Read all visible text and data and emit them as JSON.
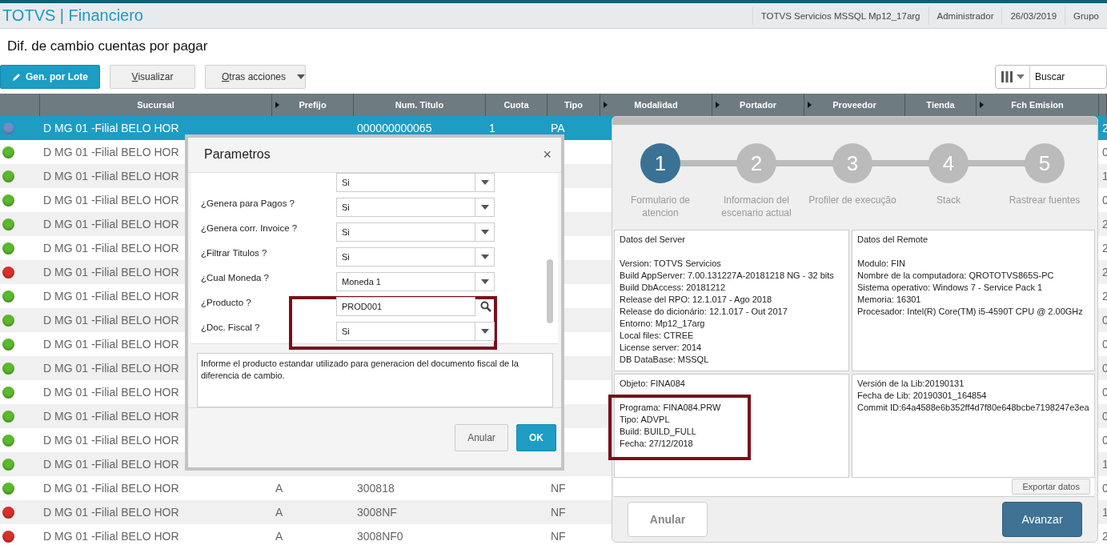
{
  "app": {
    "title": "TOTVS | Financiero",
    "info": [
      "TOTVS Servicios MSSQL Mp12_17arg",
      "Administrador",
      "26/03/2019",
      "Grupo"
    ]
  },
  "page_title": "Dif. de cambio cuentas por pagar",
  "toolbar": {
    "buttons": [
      {
        "label": "Gen. por Lote",
        "kind": "primary"
      },
      {
        "label": "Visualizar",
        "kind": "plain"
      },
      {
        "label": "Otras acciones",
        "kind": "menu"
      }
    ],
    "search": {
      "placeholder": "Buscar"
    }
  },
  "table": {
    "columns": [
      {
        "expandable": false
      },
      {
        "label": "Sucursal",
        "expandable": false
      },
      {
        "label": "Prefijo",
        "expandable": true
      },
      {
        "label": "Num. Titulo",
        "expandable": false
      },
      {
        "label": "Cuota",
        "expandable": false
      },
      {
        "label": "Tipo",
        "expandable": false
      },
      {
        "label": "Modalidad",
        "expandable": true
      },
      {
        "label": "Portador",
        "expandable": true
      },
      {
        "label": "Proveedor",
        "expandable": true
      },
      {
        "label": "Tienda",
        "expandable": false
      },
      {
        "label": "Fch Emision",
        "expandable": true
      },
      {
        "expandable": false
      }
    ],
    "rows": [
      {
        "selected": true,
        "color": "#6f8fc8",
        "cells": [
          "",
          "D MG 01 -Filial BELO HOR",
          "",
          "000000000065",
          "1",
          "PA",
          "",
          "",
          "",
          "",
          "",
          "2"
        ]
      },
      {
        "selected": false,
        "color": "#5cb82e",
        "cells": [
          "",
          "D MG 01 -Filial BELO HOR",
          "",
          "",
          "",
          "",
          "",
          "",
          "",
          "",
          "",
          "0"
        ]
      },
      {
        "selected": false,
        "color": "#5cb82e",
        "cells": [
          "",
          "D MG 01 -Filial BELO HOR",
          "",
          "",
          "",
          "",
          "",
          "",
          "",
          "",
          "",
          "1"
        ]
      },
      {
        "selected": false,
        "color": "#5cb82e",
        "cells": [
          "",
          "D MG 01 -Filial BELO HOR",
          "",
          "",
          "",
          "",
          "",
          "",
          "",
          "",
          "",
          "0"
        ]
      },
      {
        "selected": false,
        "color": "#5cb82e",
        "cells": [
          "",
          "D MG 01 -Filial BELO HOR",
          "",
          "",
          "",
          "",
          "",
          "",
          "",
          "",
          "",
          "2"
        ]
      },
      {
        "selected": false,
        "color": "#5cb82e",
        "cells": [
          "",
          "D MG 01 -Filial BELO HOR",
          "",
          "",
          "",
          "",
          "",
          "",
          "",
          "",
          "",
          "2"
        ]
      },
      {
        "selected": false,
        "color": "#d9302c",
        "cells": [
          "",
          "D MG 01 -Filial BELO HOR",
          "",
          "",
          "",
          "",
          "",
          "",
          "",
          "",
          "",
          "2"
        ]
      },
      {
        "selected": false,
        "color": "#5cb82e",
        "cells": [
          "",
          "D MG 01 -Filial BELO HOR",
          "",
          "",
          "",
          "",
          "",
          "",
          "",
          "",
          "",
          "2"
        ]
      },
      {
        "selected": false,
        "color": "#5cb82e",
        "cells": [
          "",
          "D MG 01 -Filial BELO HOR",
          "",
          "",
          "",
          "",
          "",
          "",
          "",
          "",
          "",
          "0"
        ]
      },
      {
        "selected": false,
        "color": "#5cb82e",
        "cells": [
          "",
          "D MG 01 -Filial BELO HOR",
          "",
          "",
          "",
          "",
          "",
          "",
          "",
          "",
          "",
          "0"
        ]
      },
      {
        "selected": false,
        "color": "#5cb82e",
        "cells": [
          "",
          "D MG 01 -Filial BELO HOR",
          "",
          "",
          "",
          "",
          "",
          "",
          "",
          "",
          "",
          "0"
        ]
      },
      {
        "selected": false,
        "color": "#5cb82e",
        "cells": [
          "",
          "D MG 01 -Filial BELO HOR",
          "",
          "",
          "",
          "",
          "",
          "",
          "",
          "",
          "",
          "0"
        ]
      },
      {
        "selected": false,
        "color": "#5cb82e",
        "cells": [
          "",
          "D MG 01 -Filial BELO HOR",
          "",
          "",
          "",
          "",
          "",
          "",
          "",
          "",
          "",
          "0"
        ]
      },
      {
        "selected": false,
        "color": "#5cb82e",
        "cells": [
          "",
          "D MG 01 -Filial BELO HOR",
          "",
          "",
          "",
          "",
          "",
          "",
          "",
          "",
          "",
          "0"
        ]
      },
      {
        "selected": false,
        "color": "#5cb82e",
        "cells": [
          "",
          "D MG 01 -Filial BELO HOR",
          "",
          "",
          "",
          "",
          "",
          "",
          "",
          "",
          "",
          "1"
        ]
      },
      {
        "selected": false,
        "color": "#5cb82e",
        "cells": [
          "",
          "D MG 01 -Filial BELO HOR",
          "A",
          "300818",
          "",
          "NF",
          "",
          "",
          "",
          "",
          "",
          "0"
        ]
      },
      {
        "selected": false,
        "color": "#d9302c",
        "cells": [
          "",
          "D MG 01 -Filial BELO HOR",
          "A",
          "3008NF",
          "",
          "NF",
          "",
          "",
          "",
          "",
          "",
          "1"
        ]
      },
      {
        "selected": false,
        "color": "#d9302c",
        "cells": [
          "",
          "D MG 01 -Filial BELO HOR",
          "A",
          "3008NF0",
          "",
          "NF",
          "",
          "",
          "",
          "",
          "",
          "2"
        ]
      }
    ]
  },
  "parametros": {
    "title": "Parametros",
    "close": "×",
    "fields": [
      {
        "kind": "select",
        "value": "Si"
      },
      {
        "label": "¿Genera para Pagos ?",
        "kind": "select",
        "value": "Si"
      },
      {
        "label": "¿Genera corr. Invoice ?",
        "kind": "select",
        "value": "Si"
      },
      {
        "label": "¿Filtrar Titulos ?",
        "kind": "select",
        "value": "Si"
      },
      {
        "label": "¿Cual Moneda ?",
        "kind": "select",
        "value": "Moneda 1"
      },
      {
        "label": "¿Producto ?",
        "kind": "lookup",
        "value": "PROD001"
      },
      {
        "label": "¿Doc. Fiscal ?",
        "kind": "select",
        "value": "Si"
      }
    ],
    "help": "Informe el producto estandar utilizado para generacion del documento fiscal de la diferencia de cambio.",
    "buttons": [
      {
        "label": "Anular",
        "kind": "plain"
      },
      {
        "label": "OK",
        "kind": "primary"
      }
    ]
  },
  "wizard": {
    "steps": [
      {
        "number": "1",
        "label": "Formulario de atencion",
        "selected": true
      },
      {
        "number": "2",
        "label": "Informacion del escenario actual",
        "selected": false
      },
      {
        "number": "3",
        "label": "Profiler de execução",
        "selected": false
      },
      {
        "number": "4",
        "label": "Stack",
        "selected": false
      },
      {
        "number": "5",
        "label": "Rastrear fuentes",
        "selected": false
      }
    ],
    "panels": [
      {
        "title": "Datos del Server",
        "lines": [
          "Version: TOTVS Servicios",
          "Build AppServer: 7.00.131227A-20181218 NG - 32 bits",
          "Build DbAccess: 20181212",
          "Release del RPO:  12.1.017 - Ago  2018",
          "Release do dicionário: 12.1.017 - Out  2017",
          "Entorno: Mp12_17arg",
          "Local files: CTREE",
          "License server: 2014",
          "DB DataBase: MSSQL"
        ]
      },
      {
        "title": "Datos del Remote",
        "lines": [
          "Modulo: FIN",
          "Nombre de la computadora: QROTOTVS865S-PC",
          "Sistema operativo: Windows 7 - Service Pack 1",
          "Memoria: 16301",
          "Procesador: Intel(R) Core(TM) i5-4590T CPU @ 2.00GHz"
        ]
      },
      {
        "title": "Objeto: FINA084",
        "lines": [
          "Programa: FINA084.PRW",
          "Tipo: ADVPL",
          "Build: BUILD_FULL",
          "Fecha: 27/12/2018"
        ]
      },
      {
        "lines": [
          "Versión de la Lib:20190131",
          "Fecha de Lib: 20190301_164854",
          "Commit ID:64a4588e6b352ff4d7f80e648bcbe7198247e3ea"
        ]
      }
    ],
    "export": "Exportar datos",
    "buttons": [
      {
        "label": "Anular",
        "kind": "plain"
      },
      {
        "label": "Avanzar",
        "kind": "primary"
      }
    ]
  }
}
